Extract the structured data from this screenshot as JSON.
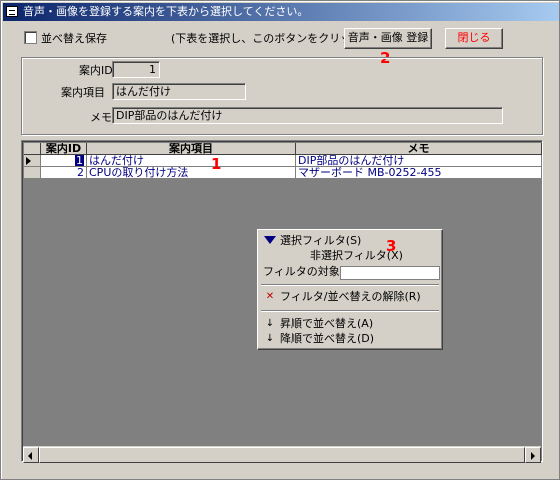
{
  "window": {
    "title": "音声・画像を登録する案内を下表から選択してください。"
  },
  "toolbar": {
    "save_sort_label": "並べ替え保存",
    "hint": "(下表を選択し、このボタンをクリック)",
    "register_label": "音声・画像 登録",
    "close_label": "閉じる"
  },
  "markers": {
    "one": "1",
    "two": "2",
    "three": "3"
  },
  "form": {
    "id_label": "案内ID",
    "id_value": "1",
    "item_label": "案内項目",
    "item_value": "はんだ付け",
    "memo_label": "メモ",
    "memo_value": "DIP部品のはんだ付け"
  },
  "grid": {
    "headers": [
      "案内ID",
      "案内項目",
      "メモ"
    ],
    "rows": [
      {
        "id": "1",
        "item": "はんだ付け",
        "memo": "DIP部品のはんだ付け"
      },
      {
        "id": "2",
        "item": "CPUの取り付け方法",
        "memo": "マザーボード MB-0252-455"
      }
    ]
  },
  "context_menu": {
    "items": [
      {
        "label": "選択フィルタ(S)",
        "icon": "filter-selection-icon"
      },
      {
        "label": "非選択フィルタ(X)"
      },
      {
        "label": "フィルタの対象(F):"
      },
      {
        "label": "フィルタ/並べ替えの解除(R)",
        "icon": "remove-filter-icon"
      },
      {
        "label": "昇順で並べ替え(A)",
        "icon": "sort-ascending-icon"
      },
      {
        "label": "降順で並べ替え(D)",
        "icon": "sort-descending-icon"
      }
    ]
  },
  "colors": {
    "title_bar": "#0a246a",
    "link_text": "#000080",
    "marker": "#ff0000",
    "close_text": "#ff0000"
  }
}
